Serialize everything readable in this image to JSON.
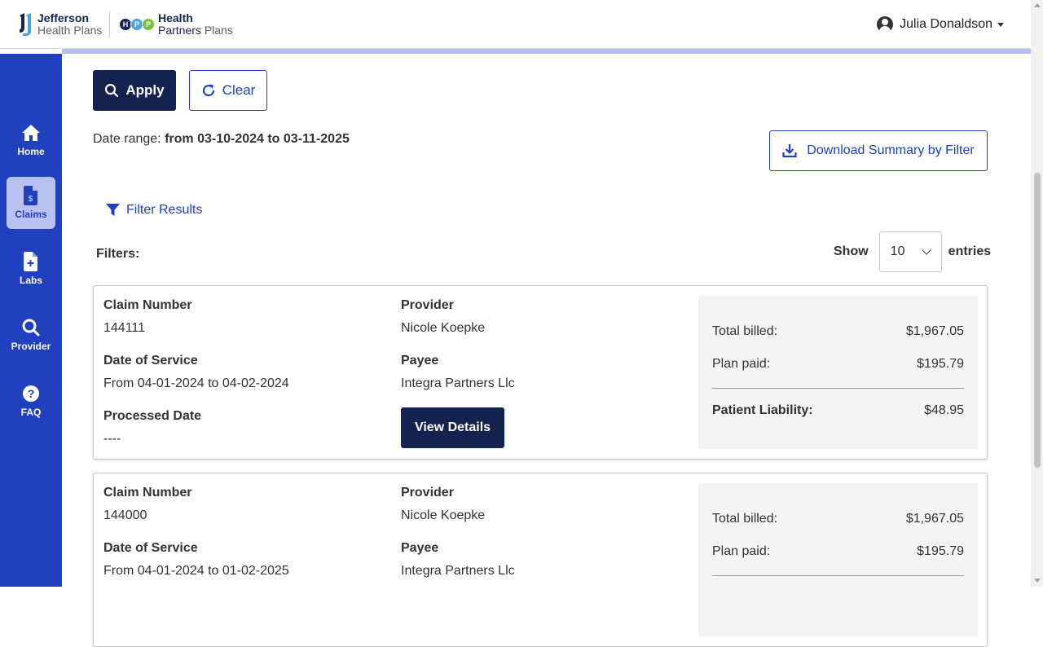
{
  "header": {
    "jefferson_line1": "Jefferson",
    "jefferson_line2": "Health Plans",
    "hpp_letters": [
      "H",
      "P",
      "P"
    ],
    "hpp_colors": [
      "#152456",
      "#4aa4e0",
      "#7bbf3e"
    ],
    "hpp_line1": "Health",
    "hpp_line2a": "Partners",
    "hpp_line2b": "Plans",
    "user_name": "Julia Donaldson"
  },
  "sidebar": {
    "items": [
      {
        "label": "Home",
        "icon": "home-icon",
        "active": false
      },
      {
        "label": "Claims",
        "icon": "claims-icon",
        "active": true
      },
      {
        "label": "Labs",
        "icon": "labs-icon",
        "active": false
      },
      {
        "label": "Provider",
        "icon": "search-icon",
        "active": false
      },
      {
        "label": "FAQ",
        "icon": "question-icon",
        "active": false
      }
    ]
  },
  "actions": {
    "apply_label": "Apply",
    "clear_label": "Clear",
    "download_label": "Download Summary by Filter"
  },
  "date_range": {
    "prefix": "Date range: ",
    "value": "from 03-10-2024 to 03-11-2025"
  },
  "filter_results_label": "Filter Results",
  "filters_label": "Filters:",
  "show_entries": {
    "show_label": "Show",
    "selected": "10",
    "entries_label": "entries"
  },
  "labels": {
    "claim_number": "Claim Number",
    "provider": "Provider",
    "date_of_service": "Date of Service",
    "payee": "Payee",
    "processed_date": "Processed Date",
    "view_details": "View Details",
    "total_billed": "Total billed:",
    "plan_paid": "Plan paid:",
    "patient_liability": "Patient Liability:"
  },
  "claims": [
    {
      "claim_number": "144111",
      "provider": "Nicole Koepke",
      "date_of_service": "From 04-01-2024 to 04-02-2024",
      "payee": "Integra Partners Llc",
      "processed_date": "----",
      "total_billed": "$1,967.05",
      "plan_paid": "$195.79",
      "patient_liability": "$48.95"
    },
    {
      "claim_number": "144000",
      "provider": "Nicole Koepke",
      "date_of_service": "From 04-01-2024 to 01-02-2025",
      "payee": "Integra Partners Llc",
      "processed_date": "",
      "total_billed": "$1,967.05",
      "plan_paid": "$195.79",
      "patient_liability": ""
    }
  ],
  "colors": {
    "sidebar": "#2140bd",
    "primary_dark": "#14224f",
    "link_blue": "#2140bd",
    "accent_bar": "#b9bff2"
  }
}
